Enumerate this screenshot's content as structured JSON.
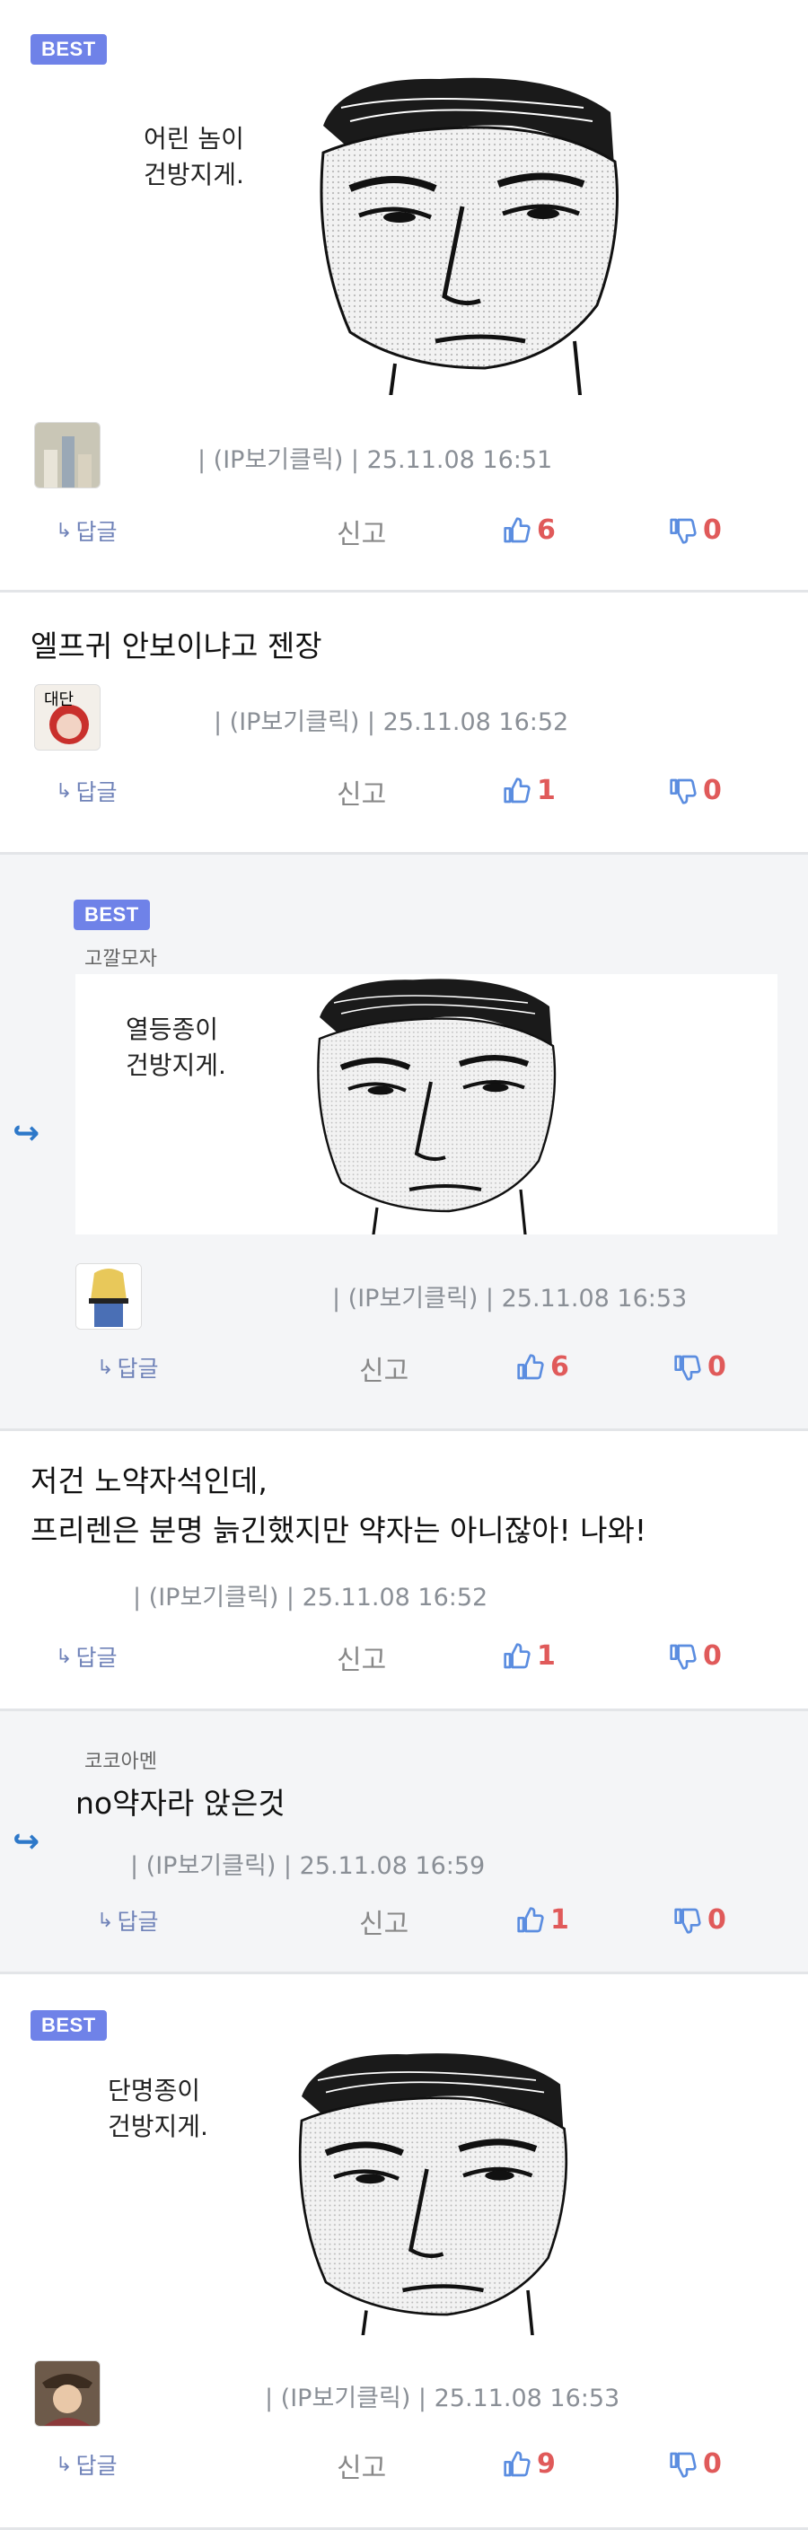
{
  "ui": {
    "best": "BEST",
    "reply_label": "답글",
    "report_label": "신고",
    "ip_label": "(IP보기클릭)",
    "colors": {
      "accent": "#6f82e8",
      "reply_arrow": "#2d78c9",
      "like": "#e05a5a",
      "dislike": "#e05a5a"
    }
  },
  "comments": [
    {
      "best": true,
      "caption": "어린 놈이\n건방지게.",
      "meta": "| (IP보기클릭) | 25.11.08 16:51",
      "up": "6",
      "down": "0"
    },
    {
      "best": false,
      "text": "엘프귀 안보이냐고 젠장",
      "meta": "| (IP보기클릭) | 25.11.08 16:52",
      "up": "1",
      "down": "0"
    },
    {
      "best": true,
      "reply": true,
      "author": "고깔모자",
      "caption": "열등종이\n건방지게.",
      "meta": "| (IP보기클릭) | 25.11.08 16:53",
      "up": "6",
      "down": "0"
    },
    {
      "best": false,
      "text1": "저건 노약자석인데,",
      "text2": "프리렌은 분명 늙긴했지만 약자는 아니잖아! 나와!",
      "meta": "| (IP보기클릭) | 25.11.08 16:52",
      "up": "1",
      "down": "0"
    },
    {
      "best": false,
      "reply": true,
      "author": "코코아멘",
      "text": "no약자라 앉은것",
      "meta": "| (IP보기클릭) | 25.11.08 16:59",
      "up": "1",
      "down": "0"
    },
    {
      "best": true,
      "caption": "단명종이\n건방지게.",
      "meta": "| (IP보기클릭) | 25.11.08 16:53",
      "up": "9",
      "down": "0"
    }
  ]
}
